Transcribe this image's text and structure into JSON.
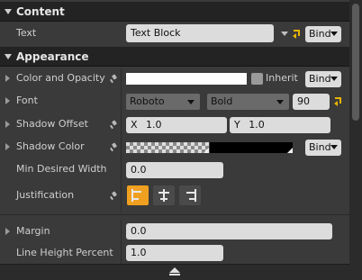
{
  "sections": {
    "content_label": "Content",
    "appearance_label": "Appearance"
  },
  "rows": {
    "text": {
      "label": "Text",
      "value": "Text Block",
      "bind": "Bind"
    },
    "color_opacity": {
      "label": "Color and Opacity",
      "inherit": "Inherit",
      "bind": "Bind"
    },
    "font": {
      "label": "Font",
      "family": "Roboto",
      "style": "Bold",
      "size": "90"
    },
    "shadow_offset": {
      "label": "Shadow Offset",
      "x_prefix": "X",
      "x_value": "1.0",
      "y_prefix": "Y",
      "y_value": "1.0"
    },
    "shadow_color": {
      "label": "Shadow Color",
      "bind": "Bind"
    },
    "min_desired_width": {
      "label": "Min Desired Width",
      "value": "0.0"
    },
    "justification": {
      "label": "Justification",
      "selected": "left"
    },
    "margin": {
      "label": "Margin",
      "value": "0.0"
    },
    "line_height": {
      "label": "Line Height Percent",
      "value": "1.0"
    }
  },
  "colors": {
    "accent_orange": "#f0a020",
    "reset_yellow": "#e8b500"
  },
  "icons": [
    "reset-arrow-icon",
    "pin-icon",
    "dropdown-caret-icon",
    "collapse-arrow-icon",
    "expand-triangle-icon",
    "align-left-icon",
    "align-center-icon",
    "align-right-icon",
    "scroll-up-icon"
  ]
}
